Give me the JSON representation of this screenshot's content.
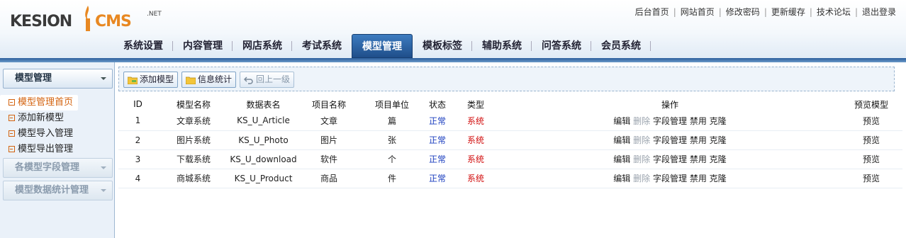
{
  "logo": {
    "brand_left": "KESION",
    "brand_right": "CMS",
    "suffix": ".NET"
  },
  "top_links": [
    "后台首页",
    "网站首页",
    "修改密码",
    "更新缓存",
    "技术论坛",
    "退出登录"
  ],
  "main_nav": {
    "tabs": [
      {
        "label": "系统设置",
        "active": false
      },
      {
        "label": "内容管理",
        "active": false
      },
      {
        "label": "网店系统",
        "active": false
      },
      {
        "label": "考试系统",
        "active": false
      },
      {
        "label": "模型管理",
        "active": true
      },
      {
        "label": "模板标签",
        "active": false
      },
      {
        "label": "辅助系统",
        "active": false
      },
      {
        "label": "问答系统",
        "active": false
      },
      {
        "label": "会员系统",
        "active": false
      }
    ]
  },
  "sidebar": {
    "section_title": "模型管理",
    "items": [
      {
        "label": "模型管理首页",
        "current": true
      },
      {
        "label": "添加新模型",
        "current": false
      },
      {
        "label": "模型导入管理",
        "current": false
      },
      {
        "label": "模型导出管理",
        "current": false
      }
    ],
    "collapsed_sections": [
      "各模型字段管理",
      "模型数据统计管理"
    ]
  },
  "toolbar": {
    "add_model": "添加模型",
    "stats": "信息统计",
    "back": "回上一级"
  },
  "table": {
    "headers": [
      "ID",
      "模型名称",
      "数据表名",
      "项目名称",
      "项目单位",
      "状态",
      "类型",
      "操作",
      "预览模型"
    ],
    "rows": [
      {
        "id": "1",
        "name": "文章系统",
        "table": "KS_U_Article",
        "item": "文章",
        "unit": "篇",
        "status": "正常",
        "type": "系统",
        "preview": "预览"
      },
      {
        "id": "2",
        "name": "图片系统",
        "table": "KS_U_Photo",
        "item": "图片",
        "unit": "张",
        "status": "正常",
        "type": "系统",
        "preview": "预览"
      },
      {
        "id": "3",
        "name": "下载系统",
        "table": "KS_U_download",
        "item": "软件",
        "unit": "个",
        "status": "正常",
        "type": "系统",
        "preview": "预览"
      },
      {
        "id": "4",
        "name": "商城系统",
        "table": "KS_U_Product",
        "item": "商品",
        "unit": "件",
        "status": "正常",
        "type": "系统",
        "preview": "预览"
      }
    ],
    "actions": {
      "edit": "编辑",
      "delete": "删除",
      "fields": "字段管理",
      "disable": "禁用",
      "clone": "克隆"
    }
  },
  "colors": {
    "accent_orange": "#d3620e",
    "nav_active": "#2b5e9c",
    "status_blue": "#1a3dbf",
    "type_red": "#d21010"
  }
}
